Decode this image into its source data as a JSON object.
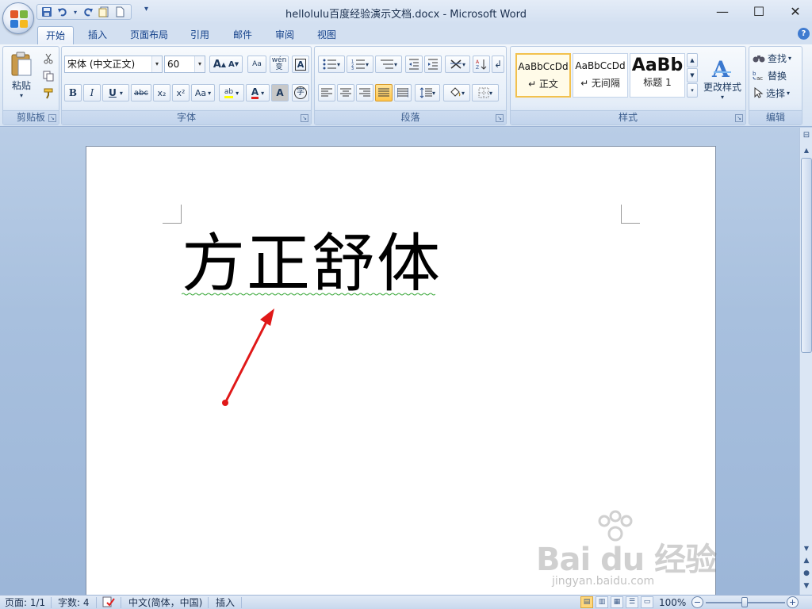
{
  "window": {
    "title": "hellolulu百度经验演示文档.docx - Microsoft Word",
    "minimize_glyph": "—",
    "maximize_glyph": "☐",
    "close_glyph": "✕"
  },
  "quick_access": {
    "save_icon": "save-icon",
    "undo_icon": "undo-icon",
    "redo_icon": "redo-icon",
    "more_glyph": "▾"
  },
  "tabs": [
    {
      "label": "开始",
      "active": true
    },
    {
      "label": "插入"
    },
    {
      "label": "页面布局"
    },
    {
      "label": "引用"
    },
    {
      "label": "邮件"
    },
    {
      "label": "审阅"
    },
    {
      "label": "视图"
    }
  ],
  "clipboard": {
    "paste_label": "粘贴",
    "group_label": "剪贴板"
  },
  "font": {
    "font_name": "宋体 (中文正文)",
    "font_size": "60",
    "grow_label": "A",
    "shrink_label": "A",
    "clear_format_label": "Aa",
    "phonetic_label": "wén 变",
    "border_label": "A",
    "bold_label": "B",
    "italic_label": "I",
    "underline_label": "U",
    "strike_label": "abc",
    "subscript_label": "x₂",
    "superscript_label": "x²",
    "case_label": "Aa",
    "highlight_label": "ab",
    "color_label": "A",
    "shade_label": "A",
    "enclose_label": "字",
    "group_label": "字体",
    "accent_red": "#e02020",
    "highlight_yellow": "#ffff00"
  },
  "paragraph": {
    "group_label": "段落"
  },
  "styles": {
    "items": [
      {
        "sample": "AaBbCcDd",
        "name": "↵ 正文",
        "selected": true
      },
      {
        "sample": "AaBbCcDd",
        "name": "↵ 无间隔"
      },
      {
        "sample": "AaBb",
        "name": "标题 1"
      }
    ],
    "change_styles_label": "更改样式",
    "group_label": "样式"
  },
  "editing": {
    "find_label": "查找",
    "replace_label": "替换",
    "select_label": "选择",
    "group_label": "编辑"
  },
  "document": {
    "body_text": "方正舒体",
    "arrow_color": "#e01818"
  },
  "watermark": {
    "logo_text": "Bai du 经验",
    "url_text": "jingyan.baidu.com"
  },
  "status": {
    "page": "页面: 1/1",
    "words": "字数: 4",
    "language": "中文(简体，中国)",
    "mode": "插入",
    "zoom": "100%",
    "zoom_minus": "−",
    "zoom_plus": "+"
  }
}
